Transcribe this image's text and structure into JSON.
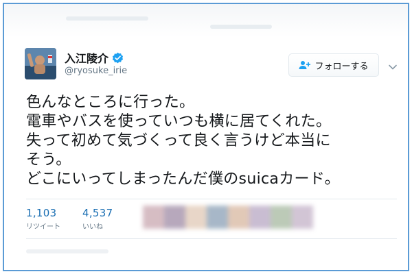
{
  "user": {
    "display_name": "入江陵介",
    "handle": "@ryosuke_irie"
  },
  "actions": {
    "follow_label": "フォローする"
  },
  "tweet": {
    "lines": [
      "色んなところに行った。",
      "電車やバスを使っていつも横に居てくれた。",
      "失って初めて気づくって良く言うけど本当に",
      "そう。",
      "どこにいってしまったんだ僕のsuicaカード。"
    ]
  },
  "stats": {
    "retweets": {
      "count": "1,103",
      "label": "リツイート"
    },
    "likes": {
      "count": "4,537",
      "label": "いいね"
    }
  },
  "colors": {
    "frame_border": "#5b9bd5",
    "stat_blue": "#1b6fb3",
    "verified_blue": "#1da1f2",
    "muted_text": "#657786"
  },
  "icons": {
    "verified": "verified-badge-icon",
    "follow": "add-person-icon",
    "more": "chevron-down-icon"
  }
}
